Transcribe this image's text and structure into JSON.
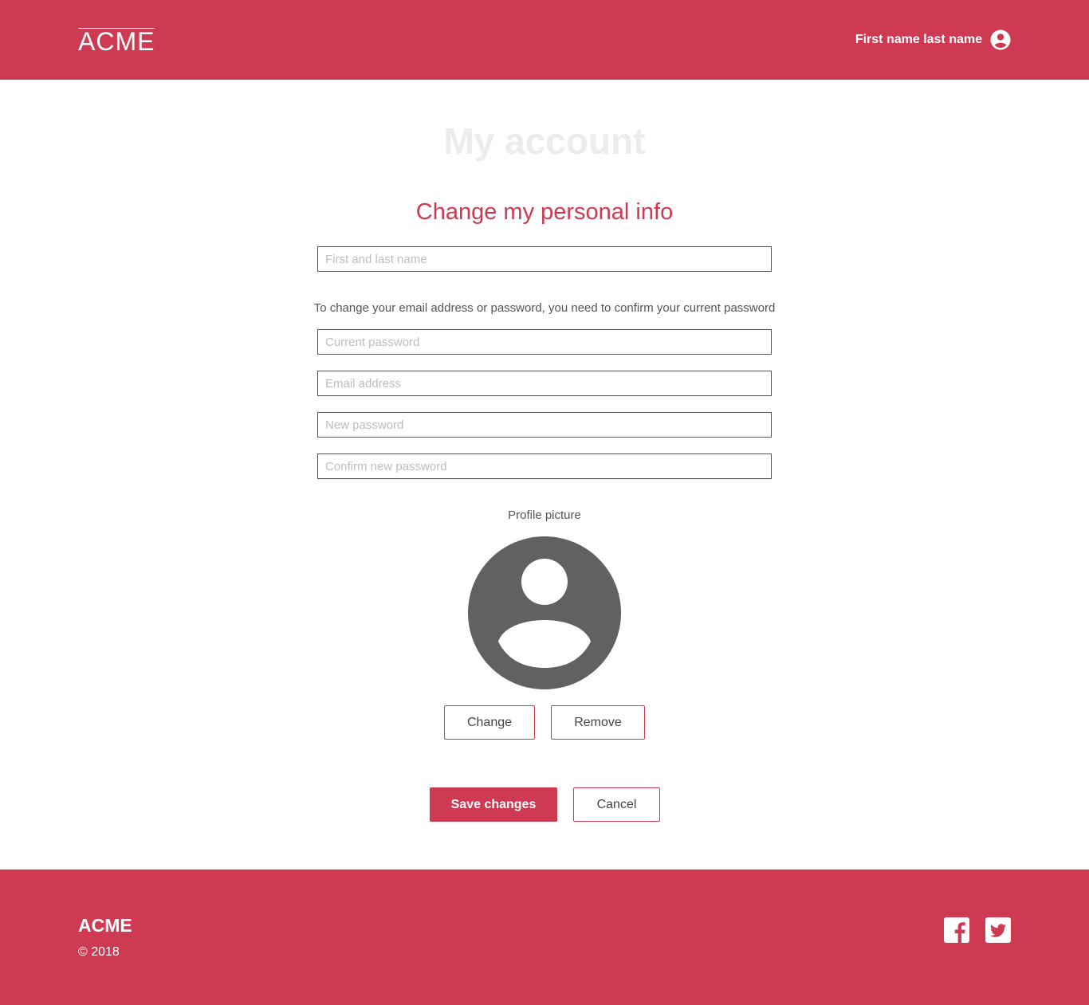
{
  "header": {
    "logo": "ACME",
    "user_name": "First name last name",
    "user_icon": "account-circle-icon"
  },
  "main": {
    "page_title": "My account",
    "section_title": "Change my personal info",
    "name_field": {
      "placeholder": "First and last name",
      "value": ""
    },
    "notice": "To change your email address or password, you need to confirm your current password",
    "current_password": {
      "placeholder": "Current password",
      "value": ""
    },
    "email": {
      "placeholder": "Email address",
      "value": ""
    },
    "new_password": {
      "placeholder": "New password",
      "value": ""
    },
    "confirm_password": {
      "placeholder": "Confirm new password",
      "value": ""
    },
    "profile_picture_label": "Profile picture",
    "avatar_icon": "default-avatar-icon",
    "change_label": "Change",
    "remove_label": "Remove",
    "save_label": "Save changes",
    "cancel_label": "Cancel"
  },
  "footer": {
    "logo": "ACME",
    "copyright": "© 2018",
    "social": [
      "facebook-icon",
      "twitter-icon"
    ]
  },
  "colors": {
    "brand": "#cd3a51",
    "text": "#555555",
    "title_muted": "#ececec",
    "avatar": "#616161"
  }
}
